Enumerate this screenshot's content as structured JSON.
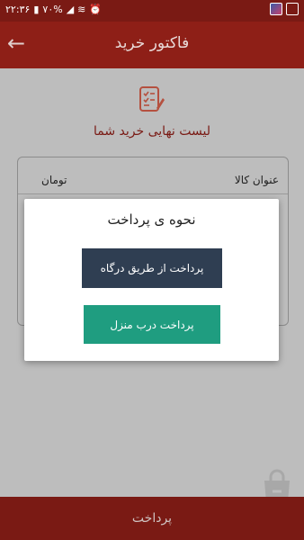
{
  "status_bar": {
    "time": "۲۲:۳۶",
    "battery": "۷۰%"
  },
  "app_bar": {
    "title": "فاکتور خرید"
  },
  "page": {
    "list_title": "لیست نهایی خرید شما"
  },
  "table": {
    "col_name": "عنوان کالا",
    "col_price": "تومان"
  },
  "dialog": {
    "title": "نحوه ی پرداخت",
    "gateway_button": "پرداخت از طریق درگاه",
    "cash_on_delivery_button": "پرداخت درب منزل"
  },
  "bottom_bar": {
    "pay_label": "پرداخت"
  },
  "colors": {
    "primary": "#8e1f17",
    "dark_primary": "#7a1a14",
    "gateway_button": "#2f3e52",
    "cod_button": "#1f9d80",
    "dim": "#bdbdbd"
  }
}
